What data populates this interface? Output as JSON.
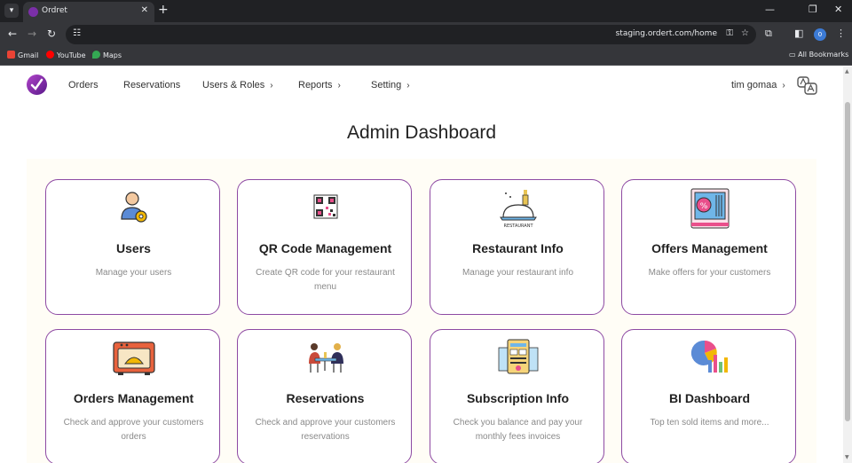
{
  "browser": {
    "tab_title": "Ordret",
    "tab_close": "✕",
    "new_tab": "+",
    "url": "staging.ordert.com/home",
    "profile_initial": "0",
    "bookmarks": [
      "Gmail",
      "YouTube",
      "Maps"
    ],
    "all_bookmarks": "All Bookmarks"
  },
  "nav": {
    "orders": "Orders",
    "reservations": "Reservations",
    "users_roles": "Users & Roles",
    "reports": "Reports",
    "setting": "Setting",
    "user_name": "tim gomaa"
  },
  "page": {
    "title": "Admin Dashboard"
  },
  "cards": [
    {
      "name": "Users",
      "desc": "Manage your users",
      "icon": "user-gear-icon"
    },
    {
      "name": "QR Code Management",
      "desc": "Create QR code for your restaurant menu",
      "icon": "qr-code-icon"
    },
    {
      "name": "Restaurant Info",
      "desc": "Manage your restaurant info",
      "icon": "restaurant-icon",
      "icon_text": "RESTAURANT"
    },
    {
      "name": "Offers Management",
      "desc": "Make offers for your customers",
      "icon": "offer-ticket-icon"
    },
    {
      "name": "Orders Management",
      "desc": "Check and approve your customers orders",
      "icon": "oven-icon"
    },
    {
      "name": "Reservations",
      "desc": "Check and approve your customers reservations",
      "icon": "dining-people-icon"
    },
    {
      "name": "Subscription Info",
      "desc": "Check you balance and pay your monthly fees invoices",
      "icon": "invoice-icon"
    },
    {
      "name": "BI Dashboard",
      "desc": "Top ten sold items and more...",
      "icon": "analytics-icon"
    }
  ],
  "colors": {
    "brand": "#7b2fa8",
    "card_border": "#8e4aa3",
    "panel_bg": "#fffdf6"
  }
}
